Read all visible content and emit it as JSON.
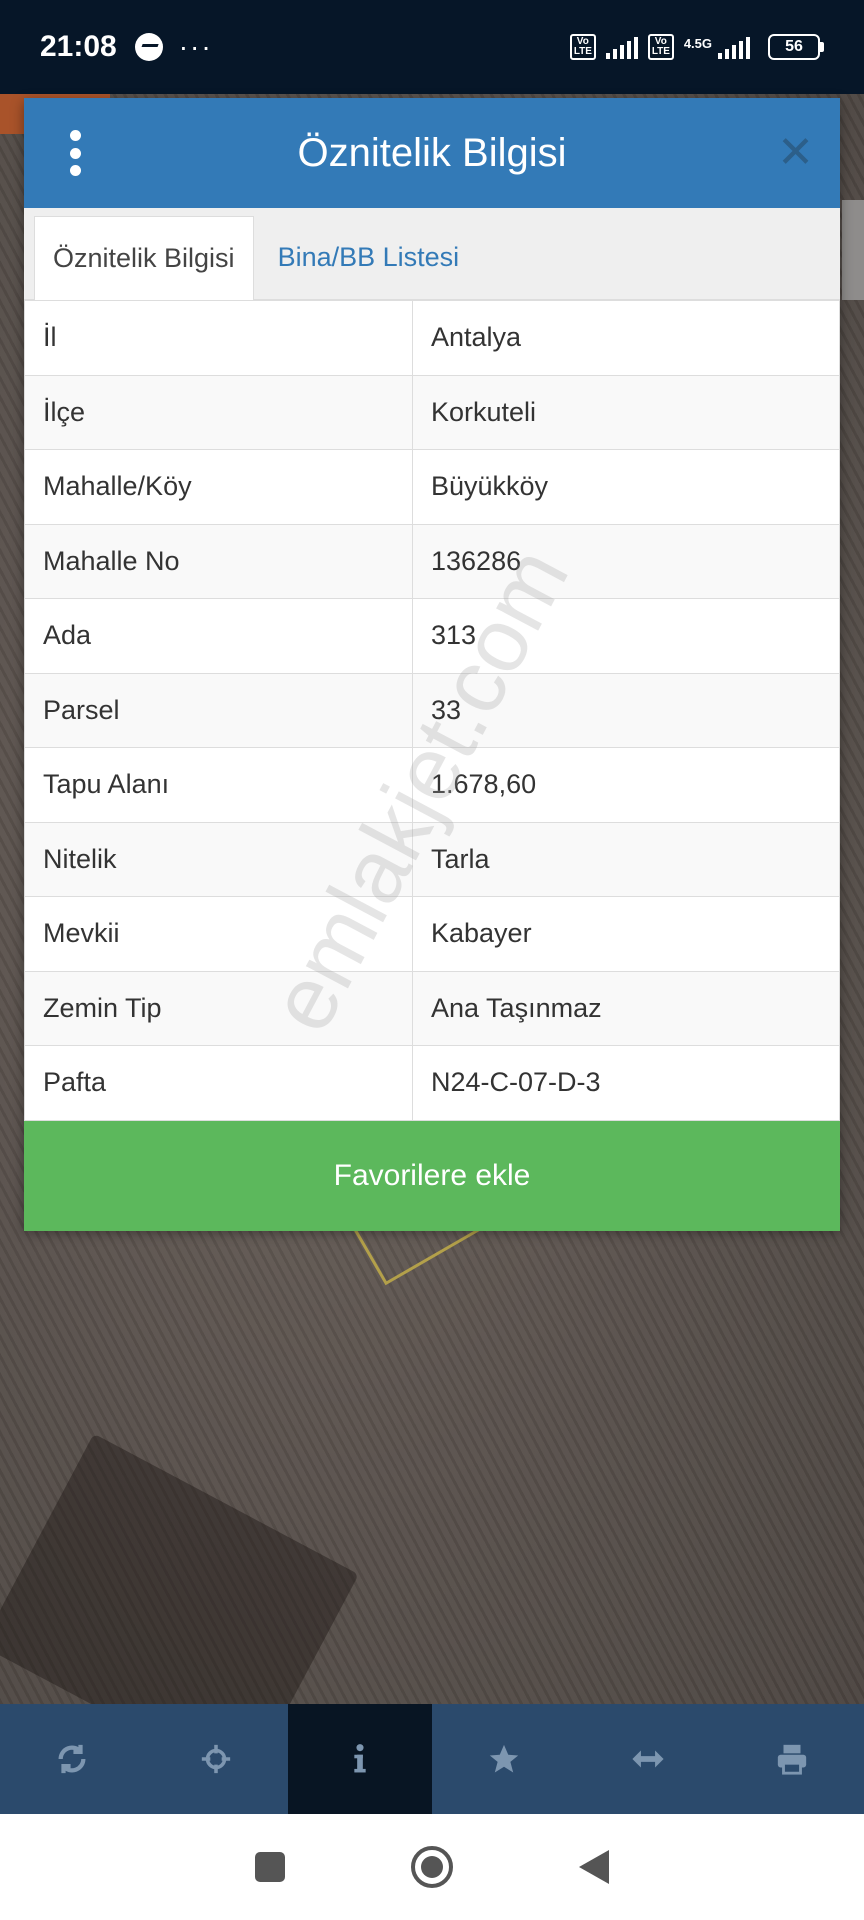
{
  "status_bar": {
    "time": "21:08",
    "more": "···",
    "volte1": "Vo LTE",
    "volte2": "Vo LTE",
    "network": "4.5G",
    "battery": "56"
  },
  "modal": {
    "title": "Öznitelik Bilgisi",
    "tabs": [
      {
        "label": "Öznitelik Bilgisi",
        "active": true
      },
      {
        "label": "Bina/BB Listesi",
        "active": false
      }
    ],
    "rows": [
      {
        "key": "İl",
        "value": "Antalya"
      },
      {
        "key": "İlçe",
        "value": "Korkuteli"
      },
      {
        "key": "Mahalle/Köy",
        "value": "Büyükköy"
      },
      {
        "key": "Mahalle No",
        "value": "136286"
      },
      {
        "key": "Ada",
        "value": "313"
      },
      {
        "key": "Parsel",
        "value": "33"
      },
      {
        "key": "Tapu Alanı",
        "value": "1.678,60"
      },
      {
        "key": "Nitelik",
        "value": "Tarla"
      },
      {
        "key": "Mevkii",
        "value": "Kabayer"
      },
      {
        "key": "Zemin Tip",
        "value": "Ana Taşınmaz"
      },
      {
        "key": "Pafta",
        "value": "N24-C-07-D-3"
      }
    ],
    "favorite_button": "Favorilere ekle"
  },
  "watermark": "emlakjet.com",
  "toolbar": {
    "items": [
      "refresh-icon",
      "locate-icon",
      "info-icon",
      "star-icon",
      "measure-icon",
      "print-icon"
    ],
    "active": "info-icon"
  },
  "colors": {
    "header": "#337ab7",
    "button": "#5cb85c",
    "toolbar": "#2b4a6c",
    "toolbar_active": "#081523",
    "status_bar": "#061628"
  }
}
